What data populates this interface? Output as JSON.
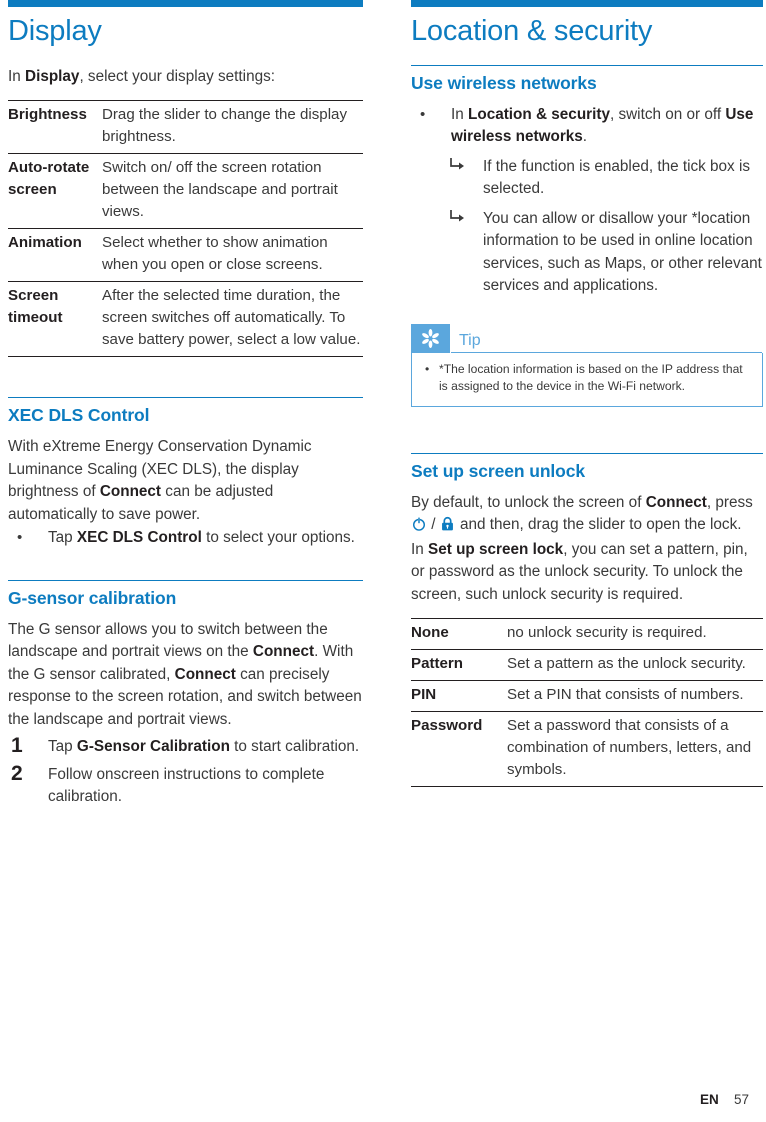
{
  "page": {
    "language_code": "EN",
    "page_number": "57",
    "accent_color": "#0d7cc0",
    "tip_color": "#5ba7dd"
  },
  "left_column": {
    "chapter_title": "Display",
    "intro": {
      "prefix": "In ",
      "bold": "Display",
      "suffix": ", select your display settings:"
    },
    "settings_table": {
      "rows": [
        {
          "term": "Brightness",
          "description": "Drag the slider to change the display brightness."
        },
        {
          "term": "Auto-rotate screen",
          "description": "Switch on/ off the screen rotation between the landscape and portrait views."
        },
        {
          "term": "Animation",
          "description": "Select whether to show animation when you open or close screens."
        },
        {
          "term": "Screen timeout",
          "description": "After the selected time duration, the screen switches off automatically. To save battery power, select a low value."
        }
      ]
    },
    "xec_section": {
      "heading": "XEC DLS Control",
      "paragraph_1": "With eXtreme Energy Conservation Dynamic Luminance Scaling (XEC DLS), the display ",
      "paragraph_1_part2": "brightness of ",
      "paragraph_1_bold": "Connect",
      "paragraph_1_part3": " can be adjusted automatically to save power.",
      "bullet_prefix": "Tap ",
      "bullet_bold": "XEC DLS Control",
      "bullet_suffix": " to select your options."
    },
    "gsensor_section": {
      "heading": "G-sensor calibration",
      "paragraph_1": "The G sensor allows you to switch between the landscape and portrait views on the ",
      "paragraph_bold_1": "Connect",
      "paragraph_2": ". With the G sensor calibrated, ",
      "paragraph_bold_2": "Connect",
      "paragraph_3": " can precisely response to the screen rotation, and switch between the landscape and portrait views.",
      "steps": [
        {
          "number": "1",
          "prefix": "Tap ",
          "bold": "G-Sensor Calibration",
          "suffix": " to start calibration."
        },
        {
          "number": "2",
          "prefix": "Follow onscreen instructions to complete calibration.",
          "bold": "",
          "suffix": ""
        }
      ]
    }
  },
  "right_column": {
    "chapter_title": "Location & security",
    "wireless_section": {
      "heading": "Use wireless networks",
      "bullet": {
        "prefix": "In ",
        "bold_1": "Location & security",
        "middle": ", switch on or off ",
        "bold_2": "Use wireless networks",
        "suffix": "."
      },
      "sub_items": [
        "If the function is enabled, the tick box is selected.",
        "You can allow or disallow your *location information to be used in online location services, such as Maps, or other relevant services and applications."
      ]
    },
    "tip": {
      "icon_name": "asterisk-icon",
      "label": "Tip",
      "items": [
        "*The location information is based on the IP address that is assigned to the device in the Wi-Fi network."
      ]
    },
    "unlock_section": {
      "heading": "Set up screen unlock",
      "paragraph_prefix": "By default, to unlock the screen of ",
      "paragraph_bold_1": "Connect",
      "paragraph_middle": ", press ",
      "icon_power": "power-icon",
      "icon_separator": " / ",
      "icon_lock": "lock-icon",
      "paragraph_after_icons": " and then, drag the slider to open the lock.",
      "paragraph_2_prefix": "In ",
      "paragraph_2_bold": "Set up screen lock",
      "paragraph_2_suffix": ", you can set a pattern, pin, or password as the unlock security. To unlock the screen, such unlock security is required.",
      "unlock_table": {
        "rows": [
          {
            "term": "None",
            "description": "no unlock security is required."
          },
          {
            "term": "Pattern",
            "description": "Set a pattern as the unlock security."
          },
          {
            "term": "PIN",
            "description": "Set a PIN that consists of numbers."
          },
          {
            "term": "Password",
            "description": "Set a password that consists of a combination of numbers, letters, and symbols."
          }
        ]
      }
    }
  }
}
